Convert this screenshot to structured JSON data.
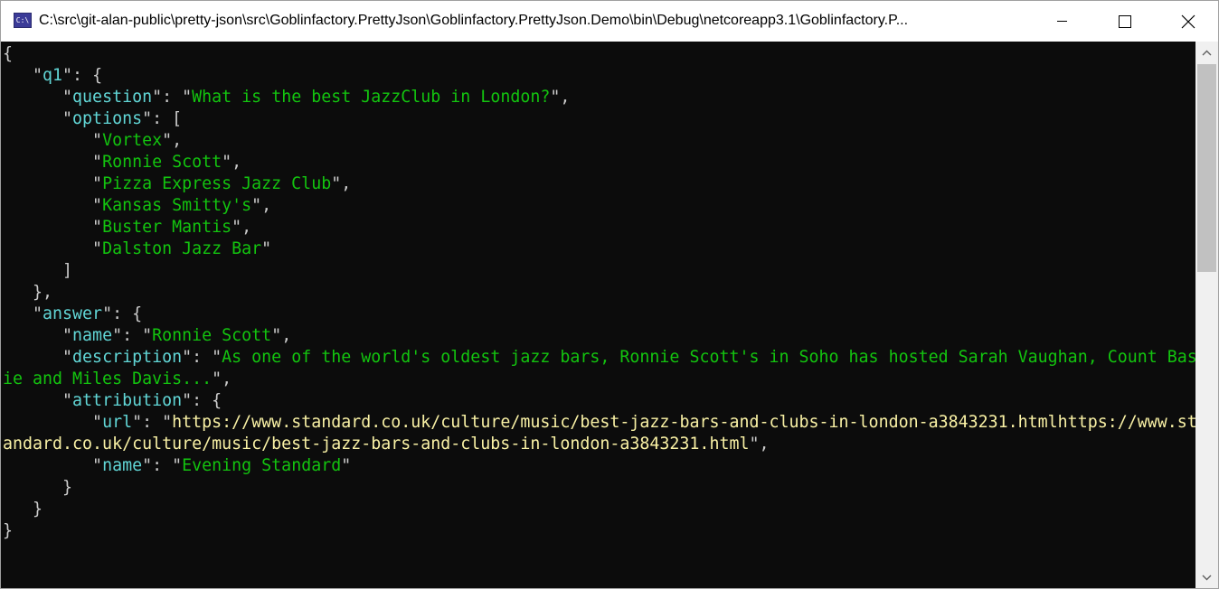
{
  "window": {
    "title": "C:\\src\\git-alan-public\\pretty-json\\src\\Goblinfactory.PrettyJson\\Goblinfactory.PrettyJson.Demo\\bin\\Debug\\netcoreapp3.1\\Goblinfactory.P...",
    "icon": "console-app-icon",
    "icon_text": "C:\\"
  },
  "colors": {
    "key": "#61d6d6",
    "string": "#13c40f",
    "url": "#f9f1a5",
    "punct": "#cccccc",
    "background": "#0c0c0c"
  },
  "console": {
    "lines": [
      [
        [
          "p",
          "{"
        ]
      ],
      [
        [
          "p",
          "   \""
        ],
        [
          "k",
          "q1"
        ],
        [
          "p",
          "\": {"
        ]
      ],
      [
        [
          "p",
          "      \""
        ],
        [
          "k",
          "question"
        ],
        [
          "p",
          "\": \""
        ],
        [
          "s",
          "What is the best JazzClub in London?"
        ],
        [
          "p",
          "\","
        ]
      ],
      [
        [
          "p",
          "      \""
        ],
        [
          "k",
          "options"
        ],
        [
          "p",
          "\": ["
        ]
      ],
      [
        [
          "p",
          "         \""
        ],
        [
          "s",
          "Vortex"
        ],
        [
          "p",
          "\","
        ]
      ],
      [
        [
          "p",
          "         \""
        ],
        [
          "s",
          "Ronnie Scott"
        ],
        [
          "p",
          "\","
        ]
      ],
      [
        [
          "p",
          "         \""
        ],
        [
          "s",
          "Pizza Express Jazz Club"
        ],
        [
          "p",
          "\","
        ]
      ],
      [
        [
          "p",
          "         \""
        ],
        [
          "s",
          "Kansas Smitty's"
        ],
        [
          "p",
          "\","
        ]
      ],
      [
        [
          "p",
          "         \""
        ],
        [
          "s",
          "Buster Mantis"
        ],
        [
          "p",
          "\","
        ]
      ],
      [
        [
          "p",
          "         \""
        ],
        [
          "s",
          "Dalston Jazz Bar"
        ],
        [
          "p",
          "\""
        ]
      ],
      [
        [
          "p",
          "      ]"
        ]
      ],
      [
        [
          "p",
          "   },"
        ]
      ],
      [
        [
          "p",
          "   \""
        ],
        [
          "k",
          "answer"
        ],
        [
          "p",
          "\": {"
        ]
      ],
      [
        [
          "p",
          "      \""
        ],
        [
          "k",
          "name"
        ],
        [
          "p",
          "\": \""
        ],
        [
          "s",
          "Ronnie Scott"
        ],
        [
          "p",
          "\","
        ]
      ],
      [
        [
          "p",
          "      \""
        ],
        [
          "k",
          "description"
        ],
        [
          "p",
          "\": \""
        ],
        [
          "s",
          "As one of the world's oldest jazz bars, Ronnie Scott's in Soho has hosted Sarah Vaughan, Count Bas"
        ]
      ],
      [
        [
          "s",
          "ie and Miles Davis..."
        ],
        [
          "p",
          "\","
        ]
      ],
      [
        [
          "p",
          "      \""
        ],
        [
          "k",
          "attribution"
        ],
        [
          "p",
          "\": {"
        ]
      ],
      [
        [
          "p",
          "         \""
        ],
        [
          "k",
          "url"
        ],
        [
          "p",
          "\": \""
        ],
        [
          "u",
          "https://www.standard.co.uk/culture/music/best-jazz-bars-and-clubs-in-london-a3843231.htmlhttps://www.st"
        ]
      ],
      [
        [
          "u",
          "andard.co.uk/culture/music/best-jazz-bars-and-clubs-in-london-a3843231.html"
        ],
        [
          "p",
          "\","
        ]
      ],
      [
        [
          "p",
          "         \""
        ],
        [
          "k",
          "name"
        ],
        [
          "p",
          "\": \""
        ],
        [
          "s",
          "Evening Standard"
        ],
        [
          "p",
          "\""
        ]
      ],
      [
        [
          "p",
          "      }"
        ]
      ],
      [
        [
          "p",
          "   }"
        ]
      ],
      [
        [
          "p",
          "}"
        ]
      ]
    ]
  }
}
